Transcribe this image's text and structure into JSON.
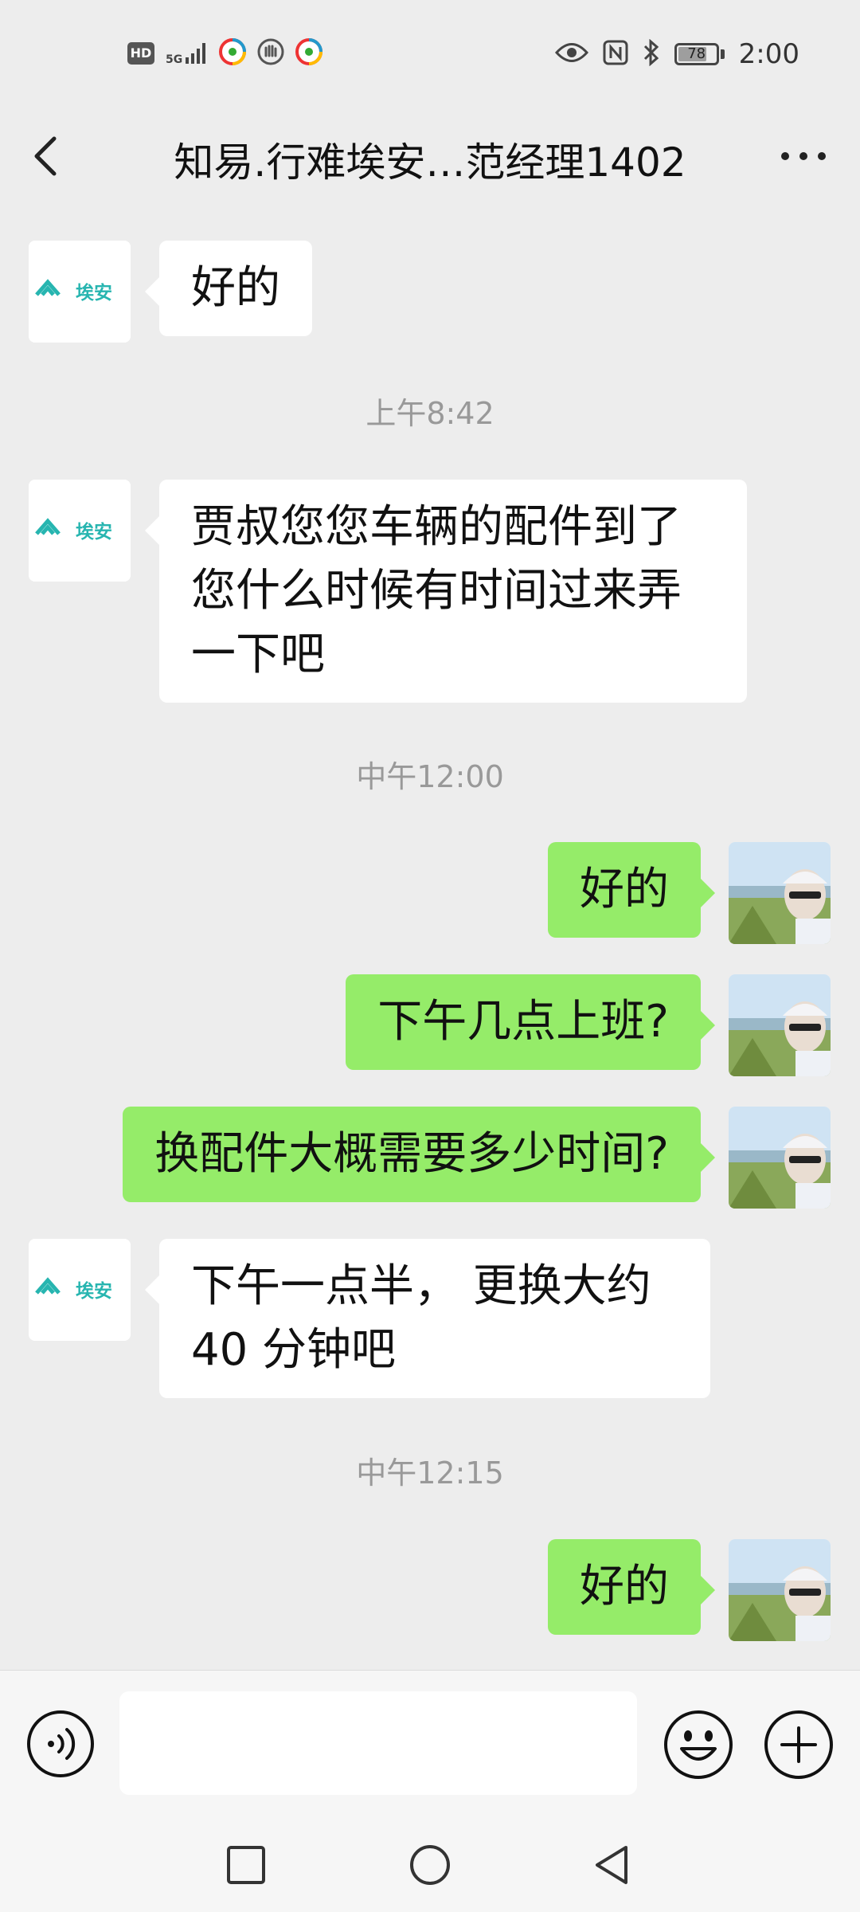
{
  "status_bar": {
    "hd_label": "HD",
    "network_label": "5G",
    "battery_level": "78",
    "battery_percent": 78,
    "time": "2:00",
    "icons": [
      "hd-icon",
      "5g-signal-icon",
      "app-notification-icon",
      "hand-icon",
      "app-notification-icon",
      "eye-icon",
      "nfc-icon",
      "bluetooth-icon",
      "battery-icon"
    ]
  },
  "header": {
    "title": "知易.行难埃安…范经理1402",
    "back_icon": "chevron-left-icon",
    "more_icon": "more-dots-icon"
  },
  "contact_avatar": {
    "logo_text": "埃安",
    "brand_color": "#27b5b0"
  },
  "messages": [
    {
      "sender": "contact",
      "text": "好的"
    },
    {
      "type": "timestamp",
      "text": "上午8:42"
    },
    {
      "sender": "contact",
      "lines": [
        "贾叔您您车辆的配件到了",
        "您什么时候有时间过来弄",
        "一下吧"
      ]
    },
    {
      "type": "timestamp",
      "text": "中午12:00"
    },
    {
      "sender": "me",
      "text": "好的"
    },
    {
      "sender": "me",
      "text": "下午几点上班?"
    },
    {
      "sender": "me",
      "text": "换配件大概需要多少时间?"
    },
    {
      "sender": "contact",
      "lines": [
        "下午一点半， 更换大约",
        "40 分钟吧"
      ]
    },
    {
      "type": "timestamp",
      "text": "中午12:15"
    },
    {
      "sender": "me",
      "text": "好的"
    }
  ],
  "input_bar": {
    "placeholder": "",
    "value": "",
    "voice_icon": "voice-input-icon",
    "emoji_icon": "emoji-icon",
    "plus_icon": "plus-circle-icon"
  },
  "nav_bar": {
    "icons": [
      "recent-apps-square-icon",
      "home-circle-icon",
      "back-triangle-icon"
    ]
  },
  "colors": {
    "background": "#ededed",
    "incoming_bubble": "#ffffff",
    "outgoing_bubble": "#95ec69",
    "timestamp_text": "#999999"
  }
}
